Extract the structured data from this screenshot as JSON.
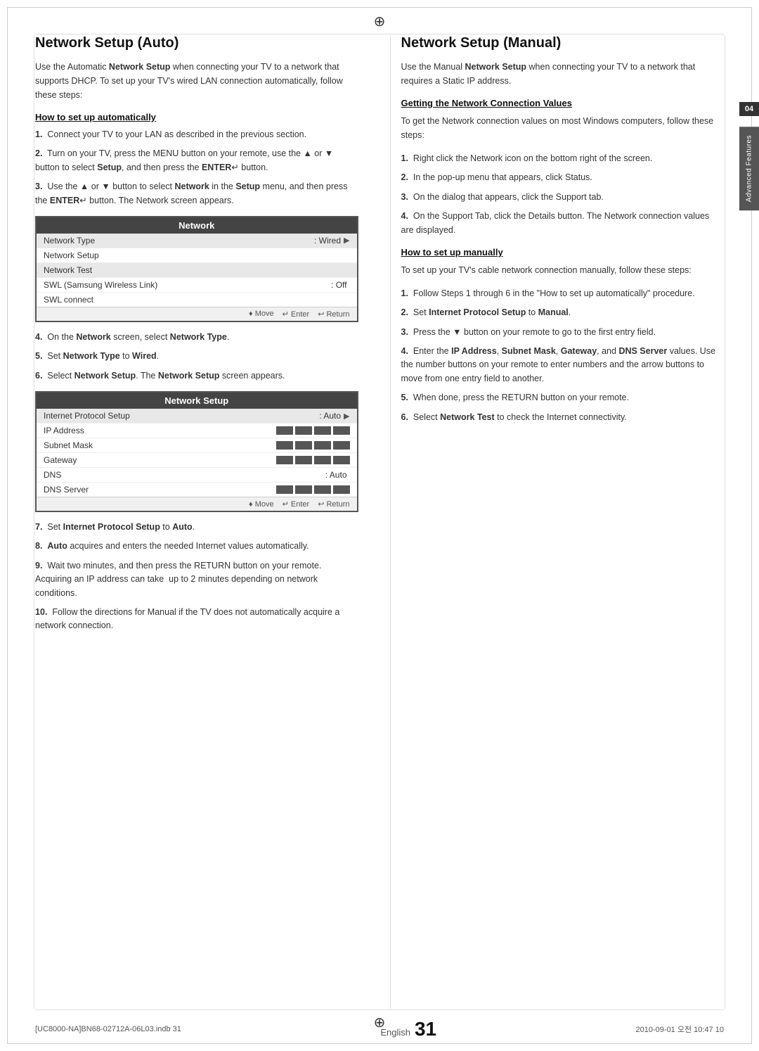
{
  "page": {
    "title": "Network Setup",
    "page_number": "31",
    "page_label": "English",
    "footer_file": "[UC8000-NA]BN68-02712A-06L03.indb  31",
    "footer_date": "2010-09-01  오전 10:47  10"
  },
  "side_tab": {
    "number": "04",
    "label": "Advanced Features"
  },
  "left_section": {
    "title": "Network Setup (Auto)",
    "intro": "Use the Automatic Network Setup when connecting your TV to a network that supports DHCP. To set up your TV's wired LAN connection automatically, follow these steps:",
    "subsection": "How to set up automatically",
    "steps": [
      "Connect your TV to your LAN as described in the previous section.",
      "Turn on your TV, press the MENU button on your remote, use the ▲ or ▼ button to select Setup, and then press the ENTER↵ button.",
      "Use the ▲ or ▼ button to select Network in the Setup menu, and then press the ENTER↵ button. The Network screen appears.",
      "On the Network screen, select Network Type.",
      "Set Network Type to Wired.",
      "Select Network Setup. The Network Setup screen appears.",
      "Set Internet Protocol Setup to Auto.",
      "Auto acquires and enters the needed Internet values automatically.",
      "Wait two minutes, and then press the RETURN button on your remote. Acquiring an IP address can take up to 2 minutes depending on network conditions.",
      "Follow the directions for Manual if the TV does not automatically acquire a network connection."
    ],
    "network_box": {
      "title": "Network",
      "rows": [
        {
          "label": "Network Type",
          "value": ": Wired",
          "arrow": true,
          "selected": true
        },
        {
          "label": "Network Setup",
          "value": "",
          "arrow": false
        },
        {
          "label": "Network Test",
          "value": "",
          "arrow": false,
          "selected": true
        },
        {
          "label": "SWL (Samsung Wireless Link)",
          "value": ": Off",
          "arrow": false
        },
        {
          "label": "SWL connect",
          "value": "",
          "arrow": false
        }
      ],
      "footer": [
        "♦ Move",
        "↵ Enter",
        "↩ Return"
      ]
    },
    "network_setup_box": {
      "title": "Network Setup",
      "rows": [
        {
          "label": "Internet Protocol Setup",
          "value": ": Auto",
          "arrow": true,
          "selected": true
        },
        {
          "label": "IP Address",
          "value": "",
          "ip_blocks": true
        },
        {
          "label": "Subnet Mask",
          "value": "",
          "ip_blocks": true
        },
        {
          "label": "Gateway",
          "value": "",
          "ip_blocks": true
        },
        {
          "label": "DNS",
          "value": ": Auto",
          "arrow": false
        },
        {
          "label": "DNS Server",
          "value": "",
          "ip_blocks": true
        }
      ],
      "footer": [
        "♦ Move",
        "↵ Enter",
        "↩ Return"
      ]
    },
    "step4_text": "On the Network screen, select Network Type.",
    "step5_text": "Set Network Type to Wired.",
    "step6_text": "Select Network Setup. The Network Setup screen appears.",
    "step7_text": "Set Internet Protocol Setup to Auto.",
    "step8_text": "Auto acquires and enters the needed Internet values automatically.",
    "step9_text": "Wait two minutes, and then press the RETURN button on your remote. Acquiring an IP address can take  up to 2 minutes depending on network conditions.",
    "step10_text": "Follow the directions for Manual if the TV does not automatically acquire a network connection."
  },
  "right_section": {
    "title": "Network Setup (Manual)",
    "intro": "Use the Manual Network Setup when connecting your TV to a network that requires a Static IP address.",
    "subsection1": "Getting the Network Connection Values",
    "subsection1_intro": "To get the Network connection values on most Windows computers, follow these steps:",
    "subsection1_steps": [
      "Right click the Network icon on the bottom right of the screen.",
      "In the pop-up menu that appears, click Status.",
      "On the dialog that appears, click the Support tab.",
      "On the Support Tab, click the Details button. The Network connection values are displayed."
    ],
    "subsection2": "How to set up manually",
    "subsection2_intro": "To set up your TV's cable network connection manually, follow these steps:",
    "subsection2_steps": [
      "Follow Steps 1 through 6 in the \"How to set up automatically\" procedure.",
      "Set Internet Protocol Setup to Manual.",
      "Press the ▼ button on your remote to go to the first entry field.",
      "Enter the IP Address, Subnet Mask, Gateway, and DNS Server values. Use the number buttons on your remote to enter numbers and the arrow buttons to move from one entry field to another.",
      "When done, press the RETURN button on your remote.",
      "Select Network Test to check the Internet connectivity."
    ]
  }
}
